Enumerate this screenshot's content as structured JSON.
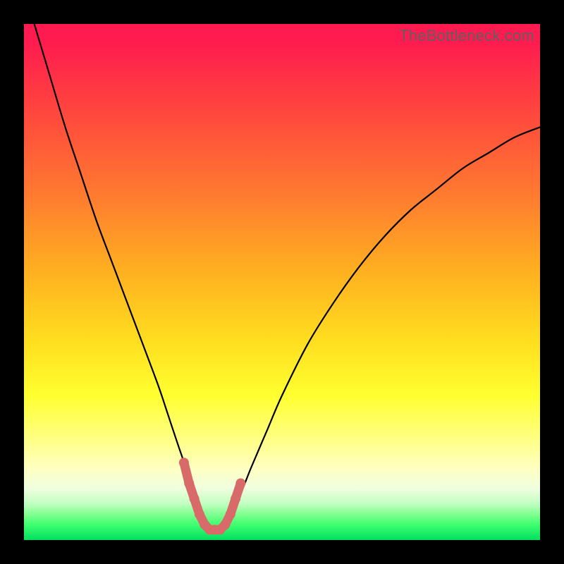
{
  "watermark": "TheBottleneck.com",
  "colors": {
    "frame": "#000000",
    "curve_stroke": "#000000",
    "marker_fill": "#d86a6a",
    "marker_stroke": "#c75a5a"
  },
  "chart_data": {
    "type": "line",
    "title": "",
    "xlabel": "",
    "ylabel": "",
    "xlim": [
      0,
      100
    ],
    "ylim": [
      0,
      100
    ],
    "series": [
      {
        "name": "bottleneck-curve",
        "x": [
          2,
          5,
          8,
          11,
          14,
          17,
          20,
          23,
          26,
          28,
          30,
          31,
          32,
          33,
          34,
          35,
          36,
          37,
          38,
          39,
          40,
          42,
          44,
          47,
          50,
          55,
          60,
          65,
          70,
          75,
          80,
          85,
          90,
          95,
          100
        ],
        "values": [
          100,
          90,
          80,
          71,
          62,
          54,
          46,
          38,
          30,
          24,
          18,
          15,
          11,
          8,
          5,
          3,
          2,
          2,
          2,
          3,
          5,
          9,
          14,
          21,
          28,
          38,
          46,
          53,
          59,
          64,
          68,
          72,
          75,
          78,
          80
        ]
      }
    ],
    "markers": {
      "name": "highlight-points",
      "x": [
        31,
        32,
        33,
        34,
        35,
        36,
        37,
        38,
        39,
        40,
        41,
        42
      ],
      "values": [
        15,
        11,
        8,
        5,
        3,
        2,
        2,
        2,
        3,
        5,
        8,
        11
      ]
    }
  }
}
